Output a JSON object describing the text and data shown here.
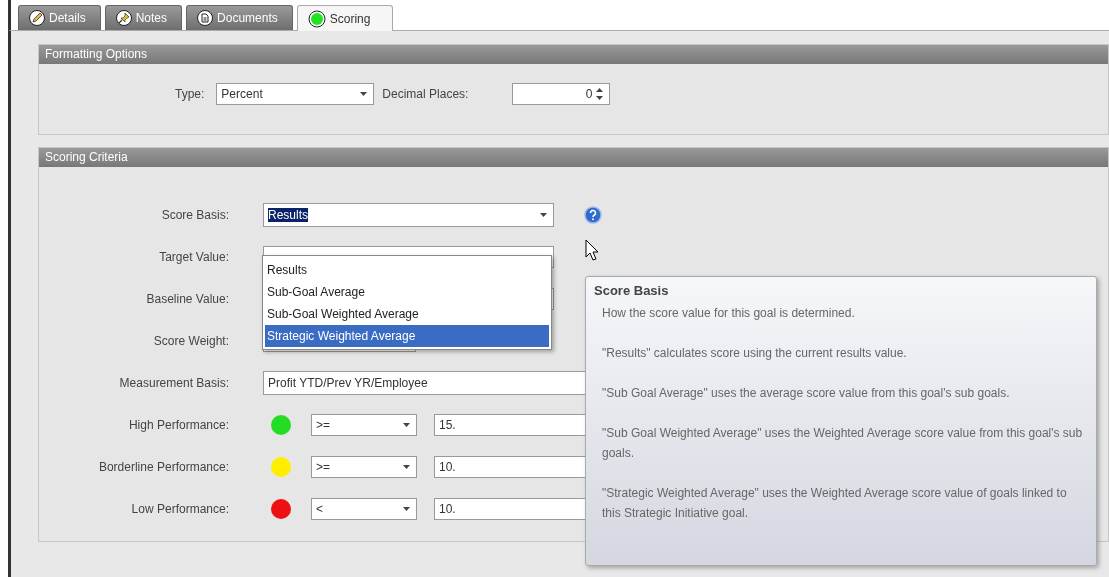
{
  "tabs": [
    {
      "label": "Details",
      "selected": false
    },
    {
      "label": "Notes",
      "selected": false
    },
    {
      "label": "Documents",
      "selected": false
    },
    {
      "label": "Scoring",
      "selected": true
    }
  ],
  "formatting_options": {
    "title": "Formatting Options",
    "type_label": "Type:",
    "type_value": "Percent",
    "decimal_label": "Decimal Places:",
    "decimal_value": "0"
  },
  "scoring_criteria": {
    "title": "Scoring Criteria",
    "score_basis": {
      "label": "Score Basis:",
      "value": "Results",
      "text_selected": true,
      "options": [
        {
          "label": "Results",
          "highlighted": false
        },
        {
          "label": "Sub-Goal Average",
          "highlighted": false
        },
        {
          "label": "Sub-Goal Weighted Average",
          "highlighted": false
        },
        {
          "label": "Strategic Weighted Average",
          "highlighted": true
        }
      ]
    },
    "target_label": "Target Value:",
    "baseline_label": "Baseline Value:",
    "weight_label": "Score Weight:",
    "measurement": {
      "label": "Measurement Basis:",
      "value": "Profit YTD/Prev YR/Employee"
    },
    "performance": [
      {
        "label": "High Performance:",
        "color": "#22dd22",
        "operator": ">=",
        "value": "15."
      },
      {
        "label": "Borderline Performance:",
        "color": "#ffee00",
        "operator": ">=",
        "value": "10."
      },
      {
        "label": "Low Performance:",
        "color": "#ee1111",
        "operator": "<",
        "value": "10."
      }
    ]
  },
  "tooltip": {
    "title": "Score Basis",
    "paragraphs": [
      "How the score value for this goal is determined.",
      "\"Results\" calculates score using the current results value.",
      "\"Sub Goal Average\" uses the average score value from this goal's sub goals.",
      "\"Sub Goal Weighted Average\" uses the Weighted Average score value from this goal's sub goals.",
      "\"Strategic Weighted Average\" uses the Weighted Average score value of goals linked to this Strategic Initiative goal."
    ]
  }
}
